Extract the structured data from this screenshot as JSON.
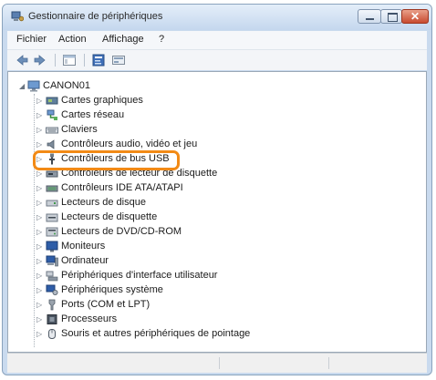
{
  "window": {
    "title": "Gestionnaire de périphériques",
    "controls": {
      "close_glyph": "✕"
    }
  },
  "menubar": {
    "items": [
      {
        "label": "Fichier"
      },
      {
        "label": "Action"
      },
      {
        "label": "Affichage"
      },
      {
        "label": "?"
      }
    ]
  },
  "toolbar": {
    "buttons": [
      {
        "icon": "back-arrow-icon"
      },
      {
        "icon": "forward-arrow-icon"
      },
      {
        "icon": "show-hide-tree-icon"
      },
      {
        "icon": "properties-icon"
      },
      {
        "icon": "scan-hardware-icon"
      }
    ]
  },
  "tree": {
    "root": {
      "label": "CANON01",
      "expanded": true
    },
    "expander": "▷",
    "expanded_marker": "◢",
    "items": [
      {
        "label": "Cartes graphiques",
        "icon": "display-adapter-icon"
      },
      {
        "label": "Cartes réseau",
        "icon": "network-adapter-icon"
      },
      {
        "label": "Claviers",
        "icon": "keyboard-icon"
      },
      {
        "label": "Contrôleurs audio, vidéo et jeu",
        "icon": "audio-icon"
      },
      {
        "label": "Contrôleurs de bus USB",
        "icon": "usb-icon",
        "highlighted": true
      },
      {
        "label": "Contrôleurs de lecteur de disquette",
        "icon": "floppy-controller-icon"
      },
      {
        "label": "Contrôleurs IDE ATA/ATAPI",
        "icon": "ide-controller-icon"
      },
      {
        "label": "Lecteurs de disque",
        "icon": "disk-drive-icon"
      },
      {
        "label": "Lecteurs de disquette",
        "icon": "floppy-drive-icon"
      },
      {
        "label": "Lecteurs de DVD/CD-ROM",
        "icon": "dvd-drive-icon"
      },
      {
        "label": "Moniteurs",
        "icon": "monitor-icon"
      },
      {
        "label": "Ordinateur",
        "icon": "computer-icon"
      },
      {
        "label": "Périphériques d'interface utilisateur",
        "icon": "hid-icon"
      },
      {
        "label": "Périphériques système",
        "icon": "system-devices-icon"
      },
      {
        "label": "Ports (COM et LPT)",
        "icon": "ports-icon"
      },
      {
        "label": "Processeurs",
        "icon": "processor-icon"
      },
      {
        "label": "Souris et autres périphériques de pointage",
        "icon": "mouse-icon"
      }
    ]
  },
  "colors": {
    "highlight": "#f28a16",
    "title_bar": "#c9daee",
    "close_button": "#c84b2f"
  }
}
